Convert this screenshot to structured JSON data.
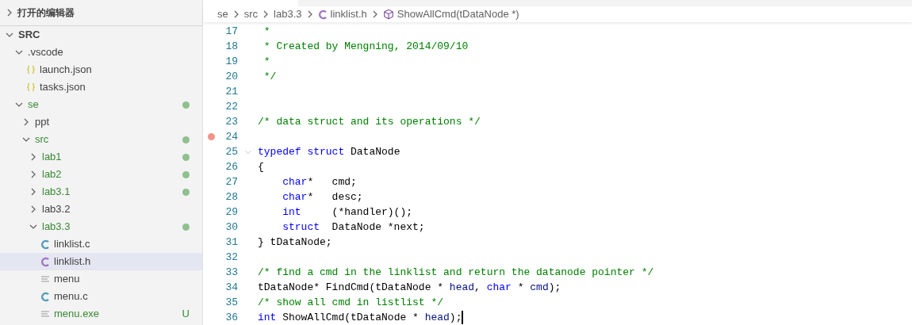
{
  "sidebar": {
    "open_editors": {
      "title": "打开的编辑器",
      "expanded": false
    },
    "tree": [
      {
        "label": "SRC",
        "kind": "root",
        "expanded": true,
        "selected": false,
        "modified": false,
        "children": [
          {
            "label": ".vscode",
            "kind": "folder",
            "expanded": true,
            "selected": false,
            "modified": false,
            "children": [
              {
                "label": "launch.json",
                "kind": "json",
                "selected": false,
                "modified": false
              },
              {
                "label": "tasks.json",
                "kind": "json",
                "selected": false,
                "modified": false
              }
            ]
          },
          {
            "label": "se",
            "kind": "folder",
            "expanded": true,
            "selected": false,
            "modified": true,
            "children": [
              {
                "label": "ppt",
                "kind": "folder",
                "expanded": false,
                "selected": false,
                "modified": false
              },
              {
                "label": "src",
                "kind": "folder",
                "expanded": true,
                "selected": false,
                "modified": true,
                "children": [
                  {
                    "label": "lab1",
                    "kind": "folder",
                    "expanded": false,
                    "selected": false,
                    "modified": true
                  },
                  {
                    "label": "lab2",
                    "kind": "folder",
                    "expanded": false,
                    "selected": false,
                    "modified": true
                  },
                  {
                    "label": "lab3.1",
                    "kind": "folder",
                    "expanded": false,
                    "selected": false,
                    "modified": true
                  },
                  {
                    "label": "lab3.2",
                    "kind": "folder",
                    "expanded": false,
                    "selected": false,
                    "modified": false
                  },
                  {
                    "label": "lab3.3",
                    "kind": "folder",
                    "expanded": true,
                    "selected": false,
                    "modified": true,
                    "children": [
                      {
                        "label": "linklist.c",
                        "kind": "c",
                        "selected": false,
                        "modified": false
                      },
                      {
                        "label": "linklist.h",
                        "kind": "h",
                        "selected": true,
                        "modified": false
                      },
                      {
                        "label": "menu",
                        "kind": "text",
                        "selected": false,
                        "modified": false
                      },
                      {
                        "label": "menu.c",
                        "kind": "c",
                        "selected": false,
                        "modified": false
                      },
                      {
                        "label": "menu.exe",
                        "kind": "text",
                        "selected": false,
                        "modified": false,
                        "badge": "U"
                      }
                    ]
                  }
                ]
              }
            ]
          }
        ]
      }
    ]
  },
  "breadcrumb": [
    {
      "label": "se",
      "kind": "folder"
    },
    {
      "label": "src",
      "kind": "folder"
    },
    {
      "label": "lab3.3",
      "kind": "folder"
    },
    {
      "label": "linklist.h",
      "kind": "h"
    },
    {
      "label": "ShowAllCmd(tDataNode *)",
      "kind": "symbol"
    }
  ],
  "editor": {
    "lines": [
      {
        "number": "17",
        "breakpoint": false,
        "foldable": false,
        "cursor": false,
        "tokens": [
          {
            "t": " *",
            "kind": "comment"
          }
        ]
      },
      {
        "number": "18",
        "breakpoint": false,
        "foldable": false,
        "cursor": false,
        "tokens": [
          {
            "t": " * Created by Mengning, 2014/09/10",
            "kind": "comment"
          }
        ]
      },
      {
        "number": "19",
        "breakpoint": false,
        "foldable": false,
        "cursor": false,
        "tokens": [
          {
            "t": " *",
            "kind": "comment"
          }
        ]
      },
      {
        "number": "20",
        "breakpoint": false,
        "foldable": false,
        "cursor": false,
        "tokens": [
          {
            "t": " */",
            "kind": "comment"
          }
        ]
      },
      {
        "number": "21",
        "breakpoint": false,
        "foldable": false,
        "cursor": false
      },
      {
        "number": "22",
        "breakpoint": false,
        "foldable": false,
        "cursor": false
      },
      {
        "number": "23",
        "breakpoint": false,
        "foldable": false,
        "cursor": false,
        "tokens": [
          {
            "t": "/* data struct and its operations */",
            "kind": "comment"
          }
        ]
      },
      {
        "number": "24",
        "breakpoint": true,
        "foldable": false,
        "cursor": false
      },
      {
        "number": "25",
        "breakpoint": false,
        "foldable": true,
        "cursor": false,
        "tokens": [
          {
            "t": "typedef",
            "kind": "keyword"
          },
          {
            "t": " struct",
            "kind": "keyword"
          },
          {
            "t": " DataNode",
            "kind": "plain"
          }
        ]
      },
      {
        "number": "26",
        "breakpoint": false,
        "foldable": false,
        "cursor": false,
        "tokens": [
          {
            "t": "{",
            "kind": "plain"
          }
        ],
        "children": [
          {
            "number": "27",
            "breakpoint": false,
            "foldable": false,
            "cursor": false,
            "tokens": [
              {
                "t": "char",
                "kind": "keyword"
              },
              {
                "t": "*   cmd;",
                "kind": "plain"
              }
            ]
          },
          {
            "number": "28",
            "breakpoint": false,
            "foldable": false,
            "cursor": false,
            "tokens": [
              {
                "t": "char",
                "kind": "keyword"
              },
              {
                "t": "*   desc;",
                "kind": "plain"
              }
            ]
          },
          {
            "number": "29",
            "breakpoint": false,
            "foldable": false,
            "cursor": false,
            "tokens": [
              {
                "t": "int",
                "kind": "keyword"
              },
              {
                "t": "     (*handler)();",
                "kind": "plain"
              }
            ]
          },
          {
            "number": "30",
            "breakpoint": false,
            "foldable": false,
            "cursor": false,
            "tokens": [
              {
                "t": "struct",
                "kind": "keyword"
              },
              {
                "t": "  DataNode *next;",
                "kind": "plain"
              }
            ]
          }
        ]
      },
      {
        "number": "31",
        "breakpoint": false,
        "foldable": false,
        "cursor": false,
        "tokens": [
          {
            "t": "} tDataNode;",
            "kind": "plain"
          }
        ]
      },
      {
        "number": "32",
        "breakpoint": false,
        "foldable": false,
        "cursor": false
      },
      {
        "number": "33",
        "breakpoint": false,
        "foldable": false,
        "cursor": false,
        "tokens": [
          {
            "t": "/* find a cmd in the linklist and return the datanode pointer */",
            "kind": "comment"
          }
        ]
      },
      {
        "number": "34",
        "breakpoint": false,
        "foldable": false,
        "cursor": false,
        "tokens": [
          {
            "t": "tDataNode* FindCmd(tDataNode * ",
            "kind": "plain"
          },
          {
            "t": "head",
            "kind": "param"
          },
          {
            "t": ", ",
            "kind": "plain"
          },
          {
            "t": "char",
            "kind": "keyword"
          },
          {
            "t": " * ",
            "kind": "plain"
          },
          {
            "t": "cmd",
            "kind": "param"
          },
          {
            "t": ");",
            "kind": "plain"
          }
        ]
      },
      {
        "number": "35",
        "breakpoint": false,
        "foldable": false,
        "cursor": false,
        "tokens": [
          {
            "t": "/* show all cmd in listlist */",
            "kind": "comment"
          }
        ]
      },
      {
        "number": "36",
        "breakpoint": false,
        "foldable": false,
        "cursor": true,
        "tokens": [
          {
            "t": "int",
            "kind": "keyword"
          },
          {
            "t": " ShowAllCmd(tDataNode * ",
            "kind": "plain"
          },
          {
            "t": "head",
            "kind": "param"
          },
          {
            "t": ");",
            "kind": "plain"
          }
        ]
      }
    ]
  }
}
